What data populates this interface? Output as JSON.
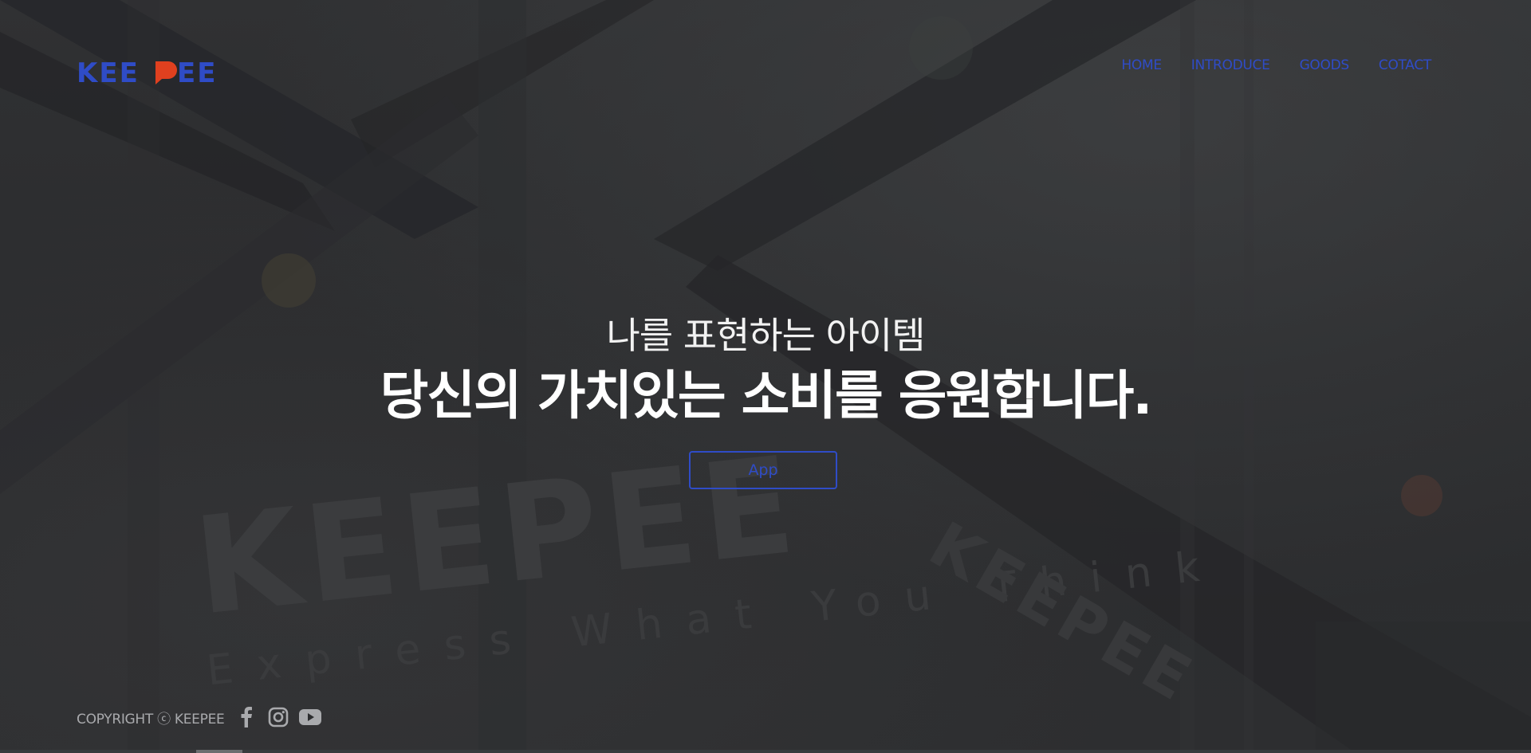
{
  "brand": {
    "logo_text": "KEEPEE",
    "primary_color": "#2f4cc7",
    "accent_color": "#e0401f"
  },
  "nav": {
    "items": [
      {
        "label": "HOME"
      },
      {
        "label": "INTRODUCE"
      },
      {
        "label": "GOODS"
      },
      {
        "label": "COTACT"
      }
    ]
  },
  "hero": {
    "subtitle": "나를 표현하는 아이템",
    "title": "당신의 가치있는 소비를 응원합니다.",
    "button_label": "App"
  },
  "background": {
    "watermark_logo": "KEEPEE",
    "watermark_tagline": "Express What You Think"
  },
  "footer": {
    "copyright": "COPYRIGHT ⓒ KEEPEE",
    "social": [
      {
        "icon": "facebook-icon"
      },
      {
        "icon": "instagram-icon"
      },
      {
        "icon": "youtube-icon"
      }
    ]
  }
}
